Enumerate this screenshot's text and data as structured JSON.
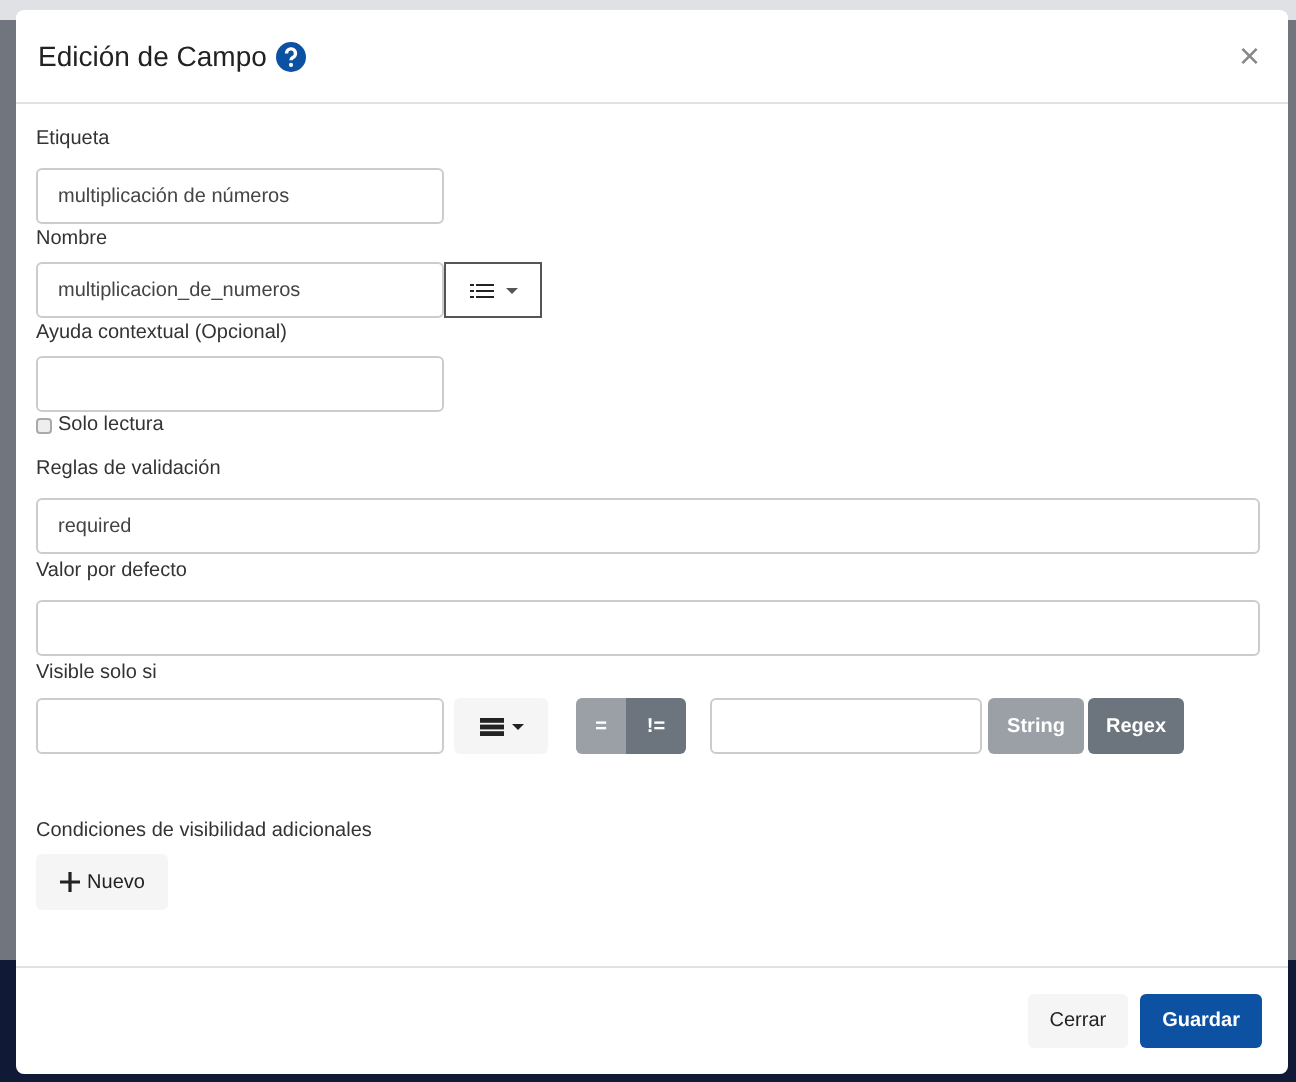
{
  "dialog": {
    "title": "Edición de Campo",
    "close": "×"
  },
  "fields": [
    {
      "kind": "text",
      "label": "Etiqueta",
      "value": "multiplicación de números"
    },
    {
      "kind": "text-menu",
      "label": "Nombre",
      "value": "multiplicacion_de_numeros"
    },
    {
      "kind": "text",
      "label": "Ayuda contextual (Opcional)"
    }
  ],
  "read_only": {
    "label": "Solo lectura",
    "checked": false
  },
  "validation": {
    "label": "Reglas de validación",
    "value": "required"
  },
  "default_value": {
    "label": "Valor por defecto"
  },
  "visible_if": {
    "label": "Visible solo si",
    "operators": [
      {
        "label": "=",
        "selected": false
      },
      {
        "label": "!=",
        "selected": true
      }
    ],
    "types": [
      {
        "label": "String",
        "selected": false
      },
      {
        "label": "Regex",
        "selected": true
      }
    ]
  },
  "extra_conditions": {
    "label": "Condiciones de visibilidad adicionales",
    "new_button": "Nuevo"
  },
  "footer": {
    "buttons": [
      {
        "label": "Cerrar",
        "kind": "secondary"
      },
      {
        "label": "Guardar",
        "kind": "primary"
      }
    ]
  }
}
